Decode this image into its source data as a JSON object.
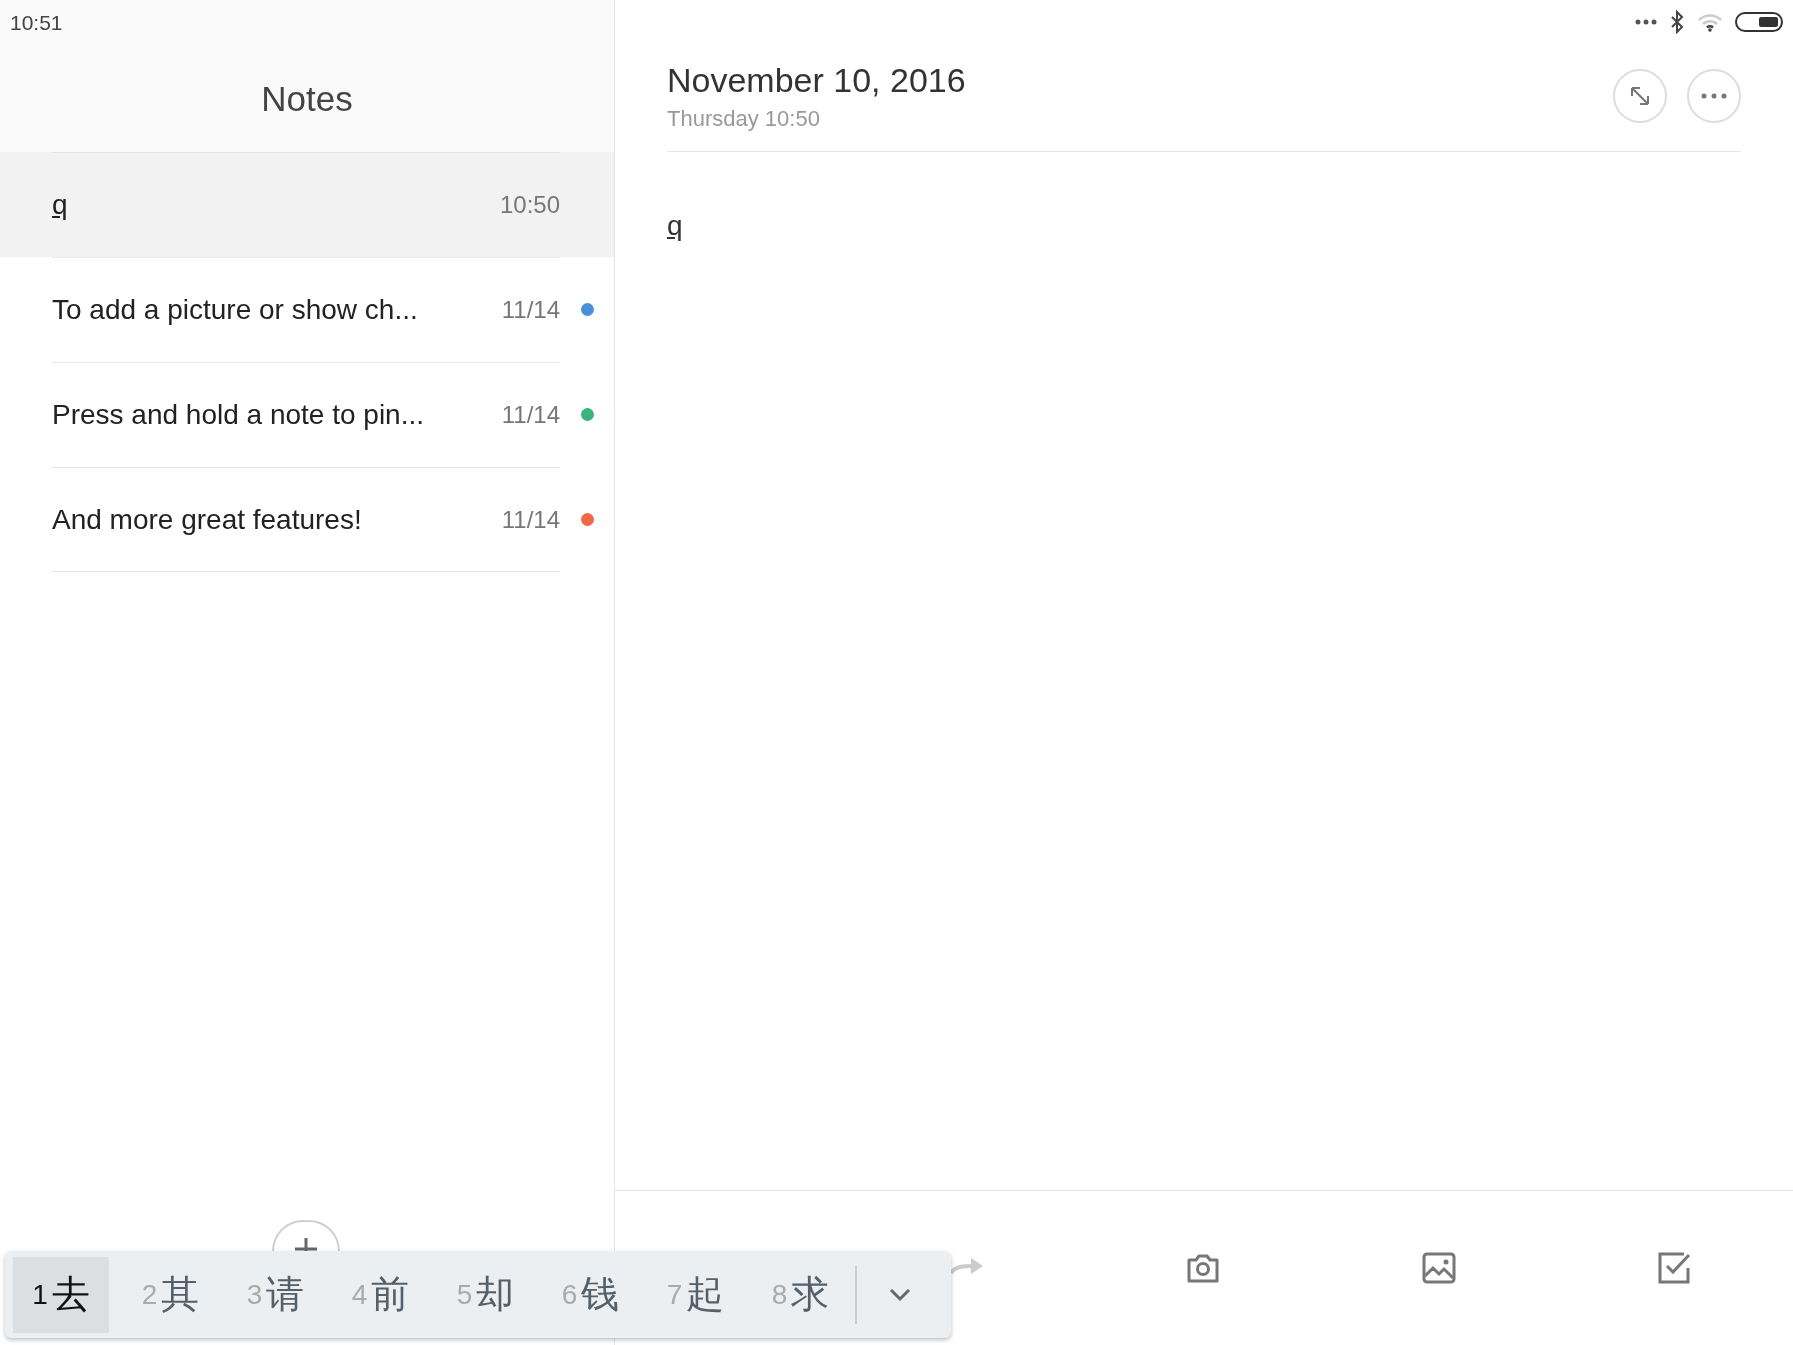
{
  "status_bar": {
    "time": "10:51"
  },
  "sidebar": {
    "title": "Notes",
    "items": [
      {
        "title": "q",
        "time": "10:50",
        "selected": true,
        "composing": true
      },
      {
        "title": "To add a picture or show ch...",
        "time": "11/14",
        "selected": false,
        "composing": false,
        "color": "#4a90d9"
      },
      {
        "title": "Press and hold a note to pin...",
        "time": "11/14",
        "selected": false,
        "composing": false,
        "color": "#3cb37f"
      },
      {
        "title": "And more great features!",
        "time": "11/14",
        "selected": false,
        "composing": false,
        "color": "#f06a4a"
      }
    ]
  },
  "note": {
    "title": "November 10, 2016",
    "subtitle": "Thursday 10:50",
    "body": "q",
    "composing": true
  },
  "candidates": [
    {
      "number": "1",
      "text": "去",
      "selected": true
    },
    {
      "number": "2",
      "text": "其",
      "selected": false
    },
    {
      "number": "3",
      "text": "请",
      "selected": false
    },
    {
      "number": "4",
      "text": "前",
      "selected": false
    },
    {
      "number": "5",
      "text": "却",
      "selected": false
    },
    {
      "number": "6",
      "text": "钱",
      "selected": false
    },
    {
      "number": "7",
      "text": "起",
      "selected": false
    },
    {
      "number": "8",
      "text": "求",
      "selected": false
    }
  ]
}
